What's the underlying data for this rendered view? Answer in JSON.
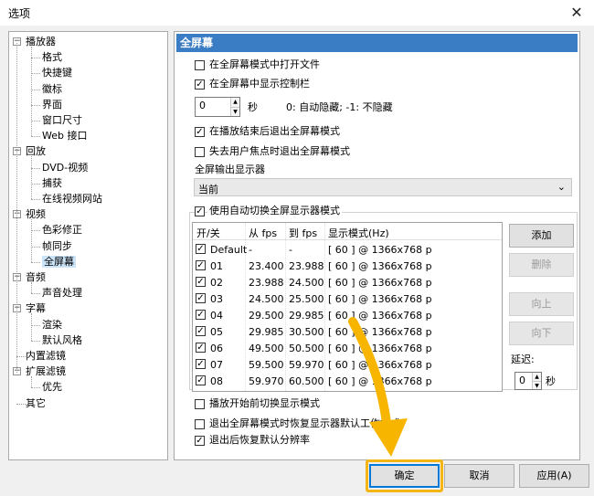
{
  "window": {
    "title": "选项",
    "close": "✕"
  },
  "tree": {
    "items": [
      {
        "label": "播放器",
        "level": 0,
        "expander": "−"
      },
      {
        "label": "格式",
        "level": 1
      },
      {
        "label": "快捷键",
        "level": 1
      },
      {
        "label": "徽标",
        "level": 1
      },
      {
        "label": "界面",
        "level": 1
      },
      {
        "label": "窗口尺寸",
        "level": 1
      },
      {
        "label": "Web 接口",
        "level": 1
      },
      {
        "label": "回放",
        "level": 0,
        "expander": "−"
      },
      {
        "label": "DVD-视频",
        "level": 1
      },
      {
        "label": "捕获",
        "level": 1
      },
      {
        "label": "在线视频网站",
        "level": 1
      },
      {
        "label": "视频",
        "level": 0,
        "expander": "−"
      },
      {
        "label": "色彩修正",
        "level": 1
      },
      {
        "label": "帧同步",
        "level": 1
      },
      {
        "label": "全屏幕",
        "level": 1,
        "selected": true
      },
      {
        "label": "音频",
        "level": 0,
        "expander": "−"
      },
      {
        "label": "声音处理",
        "level": 1
      },
      {
        "label": "字幕",
        "level": 0,
        "expander": "−"
      },
      {
        "label": "渲染",
        "level": 1
      },
      {
        "label": "默认风格",
        "level": 1
      },
      {
        "label": "内置滤镜",
        "level": 0
      },
      {
        "label": "扩展滤镜",
        "level": 0,
        "expander": "−"
      },
      {
        "label": "优先",
        "level": 1
      },
      {
        "label": "其它",
        "level": 0
      }
    ]
  },
  "panel": {
    "header": "全屏幕",
    "open_fullscreen": {
      "label": "在全屏幕模式中打开文件",
      "checked": false
    },
    "show_controls": {
      "label": "在全屏幕中显示控制栏",
      "checked": true
    },
    "hide_delay": {
      "value": "0",
      "unit": "秒",
      "hint": "0: 自动隐藏; -1: 不隐藏"
    },
    "exit_on_end": {
      "label": "在播放结束后退出全屏幕模式",
      "checked": true
    },
    "exit_on_focus": {
      "label": "失去用户焦点时退出全屏幕模式",
      "checked": false
    },
    "output_monitor_label": "全屏输出显示器",
    "output_monitor_value": "当前",
    "auto_switch": {
      "label": "使用自动切换全屏显示器模式",
      "checked": true
    },
    "list_headers": {
      "onoff": "开/关",
      "from": "从 fps",
      "to": "到 fps",
      "mode": "显示模式(Hz)"
    },
    "rows": [
      {
        "name": "Default",
        "from": "-",
        "to": "-",
        "mode": "[ 60 ]  @ 1366x768 p",
        "checked": true
      },
      {
        "name": "01",
        "from": "23.400",
        "to": "23.988",
        "mode": "[ 60 ]  @ 1366x768 p",
        "checked": true
      },
      {
        "name": "02",
        "from": "23.988",
        "to": "24.500",
        "mode": "[ 60 ]  @ 1366x768 p",
        "checked": true
      },
      {
        "name": "03",
        "from": "24.500",
        "to": "25.500",
        "mode": "[ 60 ]  @ 1366x768 p",
        "checked": true
      },
      {
        "name": "04",
        "from": "29.500",
        "to": "29.985",
        "mode": "[ 60 ]  @ 1366x768 p",
        "checked": true
      },
      {
        "name": "05",
        "from": "29.985",
        "to": "30.500",
        "mode": "[ 60 ]  @ 1366x768 p",
        "checked": true
      },
      {
        "name": "06",
        "from": "49.500",
        "to": "50.500",
        "mode": "[ 60 ]  @ 1366x768 p",
        "checked": true
      },
      {
        "name": "07",
        "from": "59.500",
        "to": "59.970",
        "mode": "[ 60 ]  @ 1366x768 p",
        "checked": true
      },
      {
        "name": "08",
        "from": "59.970",
        "to": "60.500",
        "mode": "[ 60 ]  @ 1366x768 p",
        "checked": true
      }
    ],
    "buttons": {
      "add": "添加",
      "delete": "删除",
      "up": "向上",
      "down": "向下"
    },
    "delay": {
      "label": "延迟:",
      "value": "0",
      "unit": "秒"
    },
    "switch_before_play": {
      "label": "播放开始前切换显示模式",
      "checked": false
    },
    "restore_on_exit": {
      "label": "退出全屏幕模式时恢复显示器默认工作模式",
      "checked": false
    },
    "restore_resolution": {
      "label": "退出后恢复默认分辨率",
      "checked": true
    }
  },
  "footer": {
    "ok": "确定",
    "cancel": "取消",
    "apply": "应用(A)"
  },
  "check_mark": "✓",
  "colors": {
    "header_blue": "#3b7dc4",
    "highlight": "#f5b615",
    "focus": "#0078d7"
  }
}
